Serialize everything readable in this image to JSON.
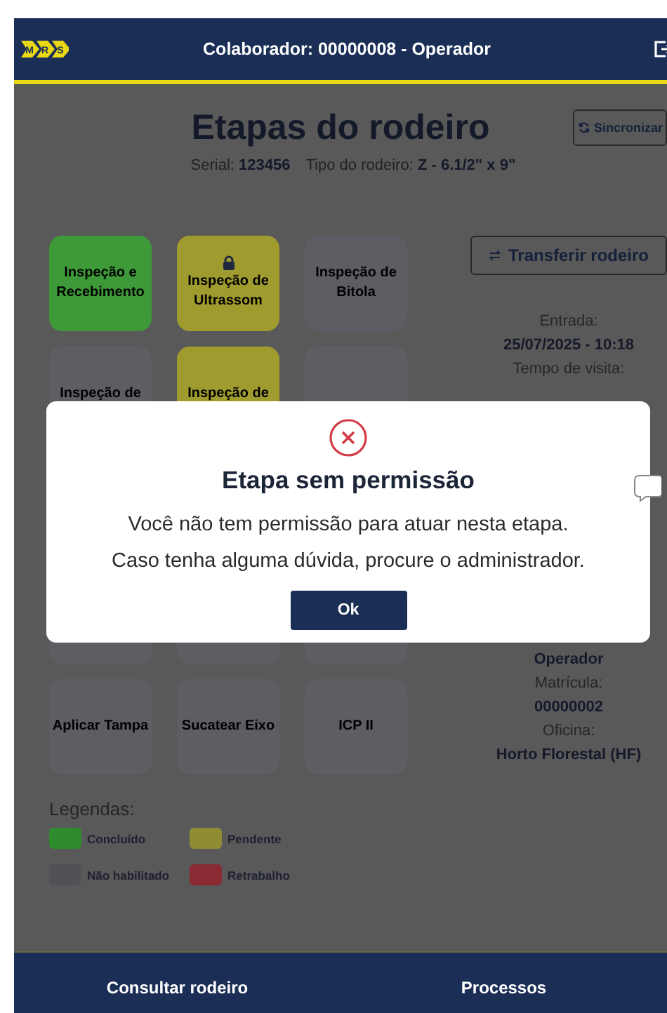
{
  "header": {
    "logo_letters": [
      "M",
      "R",
      "S"
    ],
    "title": "Colaborador: 00000008 - Operador"
  },
  "page": {
    "title": "Etapas do rodeiro",
    "sync_button": "Sincronizar",
    "serial_label": "Serial:",
    "serial": "123456",
    "type_label": "Tipo do rodeiro:",
    "type": "Z - 6.1/2\" x 9\""
  },
  "stages": {
    "upper_rows": [
      [
        {
          "label": "Inspeção e Recebimento",
          "color": "#3e9a38",
          "locked": false
        },
        {
          "label": "Inspeção de Ultrassom",
          "color": "#a09b2e",
          "locked": true
        },
        {
          "label": "Inspeção de Bitola",
          "color": "#5c5e64",
          "locked": false
        }
      ],
      [
        {
          "label": "Inspeção de",
          "color": "#5c5e64",
          "locked": false
        },
        {
          "label": "Inspeção de",
          "color": "#a09b2e",
          "locked": false
        },
        {
          "color": "#5c5e64",
          "locked": false
        }
      ]
    ],
    "lower_rows": [
      [
        {
          "color": "#5c5e64",
          "locked": false
        },
        {
          "color": "#5c5e64",
          "locked": false
        },
        {
          "color": "#5c5e64",
          "locked": false
        }
      ],
      [
        {
          "label": "Aplicar Tampa",
          "color": "#5c5e64",
          "locked": false
        },
        {
          "label": "Sucatear Eixo",
          "color": "#5c5e64",
          "locked": false
        },
        {
          "label": "ICP II",
          "color": "#5c5e64",
          "locked": false
        }
      ]
    ]
  },
  "side_panel": {
    "transfer_button": "Transferir rodeiro",
    "upper_fields": [
      {
        "label": "Entrada:",
        "value": "25/07/2025 - 10:18"
      },
      {
        "label": "Tempo de visita:"
      }
    ],
    "lower_fields": [
      {
        "value": "Operador"
      },
      {
        "label": "Matrícula:",
        "value": "00000002"
      },
      {
        "label": "Oficina:",
        "value": "Horto Florestal (HF)"
      }
    ]
  },
  "legend": {
    "title": "Legendas:",
    "items": [
      {
        "label": "Concluído",
        "color": "#2e8c2c"
      },
      {
        "label": "Pendente",
        "color": "#8f8c34"
      },
      {
        "label": "Não habilitado",
        "color": "#505257"
      },
      {
        "label": "Retrabalho",
        "color": "#8a2a33"
      }
    ]
  },
  "dialog": {
    "title": "Etapa sem permissão",
    "message": [
      "Você não tem permissão para atuar nesta etapa.",
      "Caso tenha alguma dúvida, procure o administrador."
    ],
    "button": "Ok"
  },
  "bottom_nav": [
    {
      "label": "Consultar rodeiro"
    },
    {
      "label": "Processos"
    }
  ]
}
